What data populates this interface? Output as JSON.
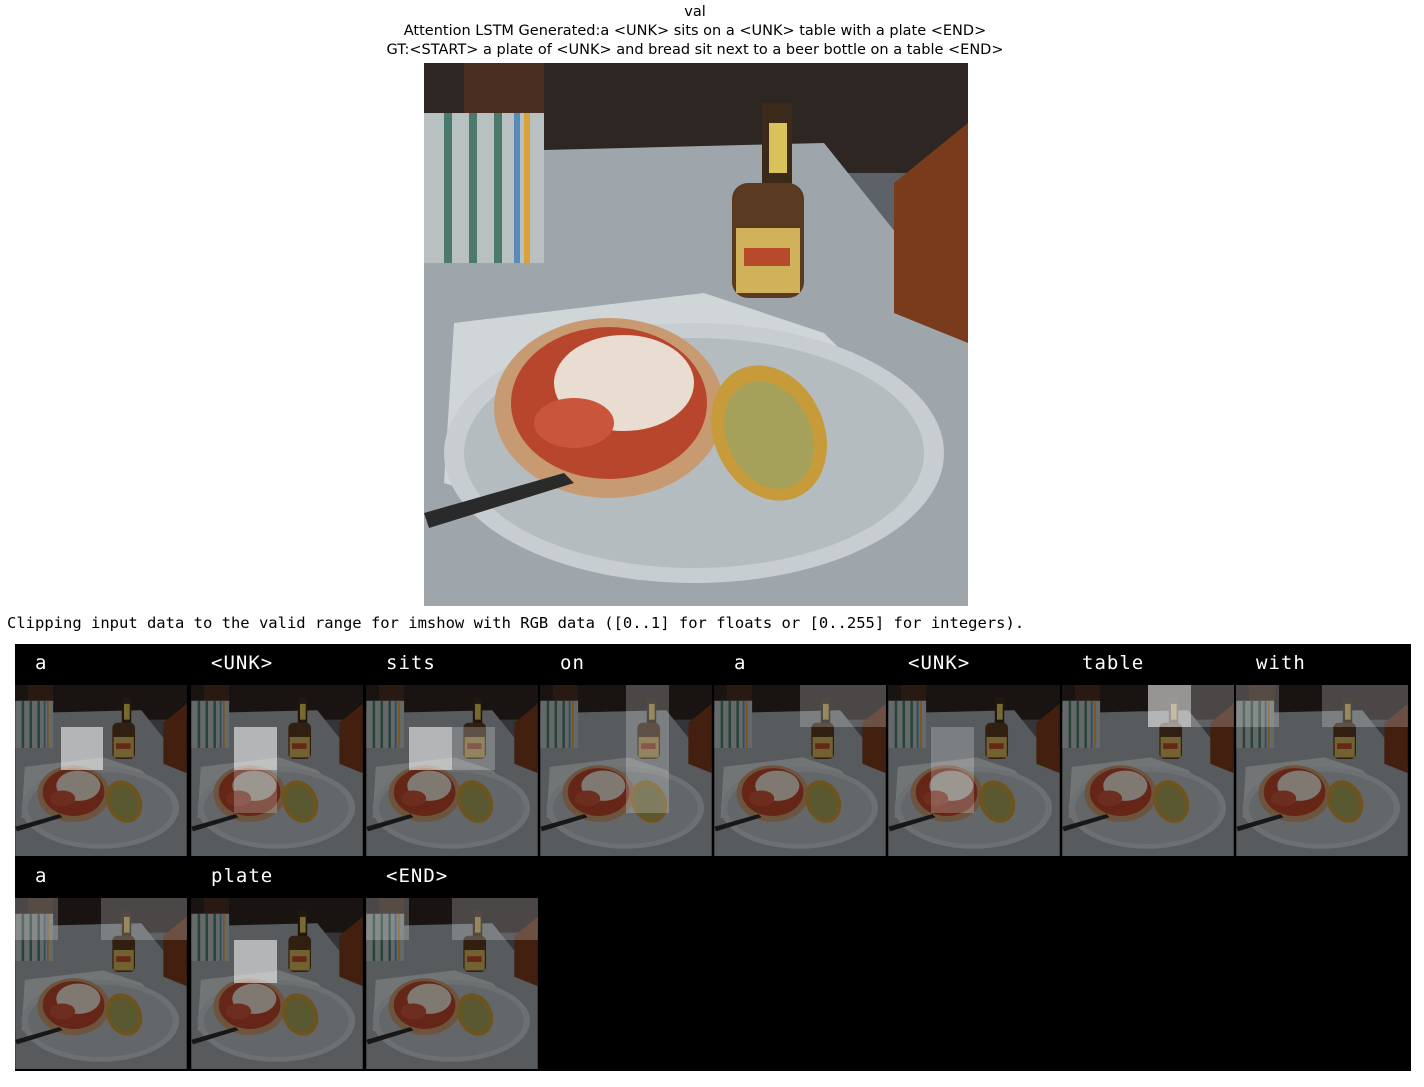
{
  "figure": {
    "split": "val",
    "generated_caption": "Attention LSTM Generated:a <UNK> sits on a <UNK> table with a plate <END>",
    "ground_truth": "GT:<START> a plate of <UNK> and bread sit next to a beer bottle on a table <END>"
  },
  "console": {
    "warning": "Clipping input data to the valid range for imshow with RGB data ([0..1] for floats or [0..255] for integers)."
  },
  "attention_steps": [
    {
      "word": "a"
    },
    {
      "word": "<UNK>"
    },
    {
      "word": "sits"
    },
    {
      "word": "on"
    },
    {
      "word": "a"
    },
    {
      "word": "<UNK>"
    },
    {
      "word": "table"
    },
    {
      "word": "with"
    },
    {
      "word": "a"
    },
    {
      "word": "plate"
    },
    {
      "word": "<END>"
    }
  ],
  "colors": {
    "grid_background": "#000000",
    "word_label": "#ffffff"
  }
}
